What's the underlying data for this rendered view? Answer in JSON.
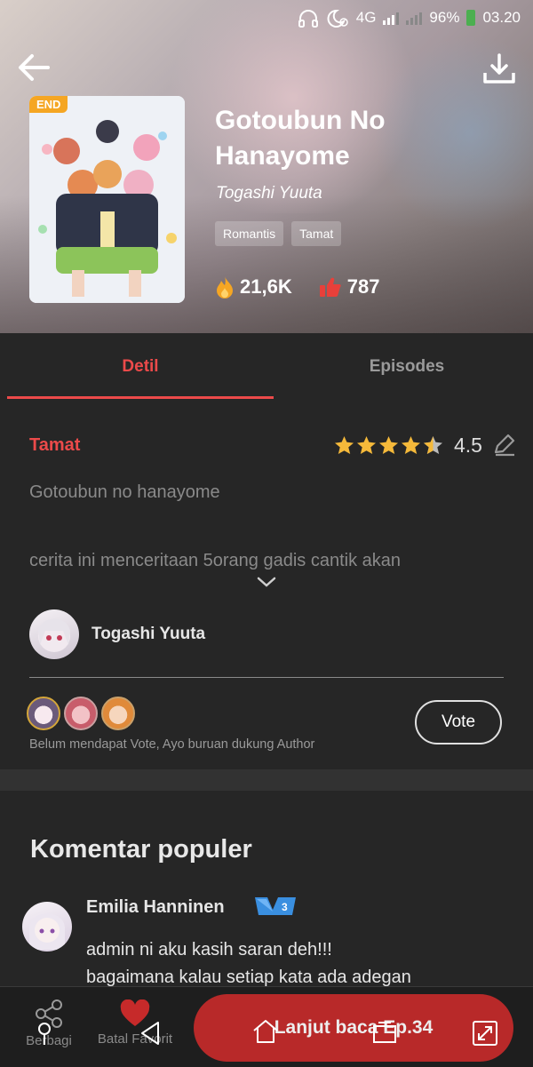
{
  "status_bar": {
    "network": "4G",
    "sim1": "1",
    "sim2": "2",
    "battery": "96%",
    "time": "03.20"
  },
  "comic": {
    "title": "Gotoubun No Hanayome",
    "author": "Togashi Yuuta",
    "badge": "END",
    "tags": [
      "Romantis",
      "Tamat"
    ],
    "views": "21,6K",
    "likes": "787"
  },
  "tabs": {
    "detail": "Detil",
    "episodes": "Episodes"
  },
  "detail": {
    "status": "Tamat",
    "rating": "4.5",
    "rating_stars": 4.5,
    "title_line": "Gotoubun no hanayome",
    "synopsis": "cerita ini menceritaan 5orang gadis cantik akan",
    "author_name": "Togashi Yuuta",
    "vote_note": "Belum mendapat Vote, Ayo buruan dukung Author",
    "vote_button": "Vote"
  },
  "comments": {
    "heading": "Komentar populer",
    "items": [
      {
        "name": "Emilia Hanninen",
        "level": "3",
        "line1": "admin ni aku kasih saran deh!!!",
        "line2": "bagaimana kalau setiap kata ada adegan"
      }
    ]
  },
  "bottom_bar": {
    "share": "Berbagi",
    "favorite": "Batal Favorit",
    "read": "Lanjut baca Ep.34"
  },
  "colors": {
    "accent": "#ec4a4a",
    "badge": "#f5a623",
    "star": "#f5b93a",
    "level_badge": "#3a8fe0"
  }
}
